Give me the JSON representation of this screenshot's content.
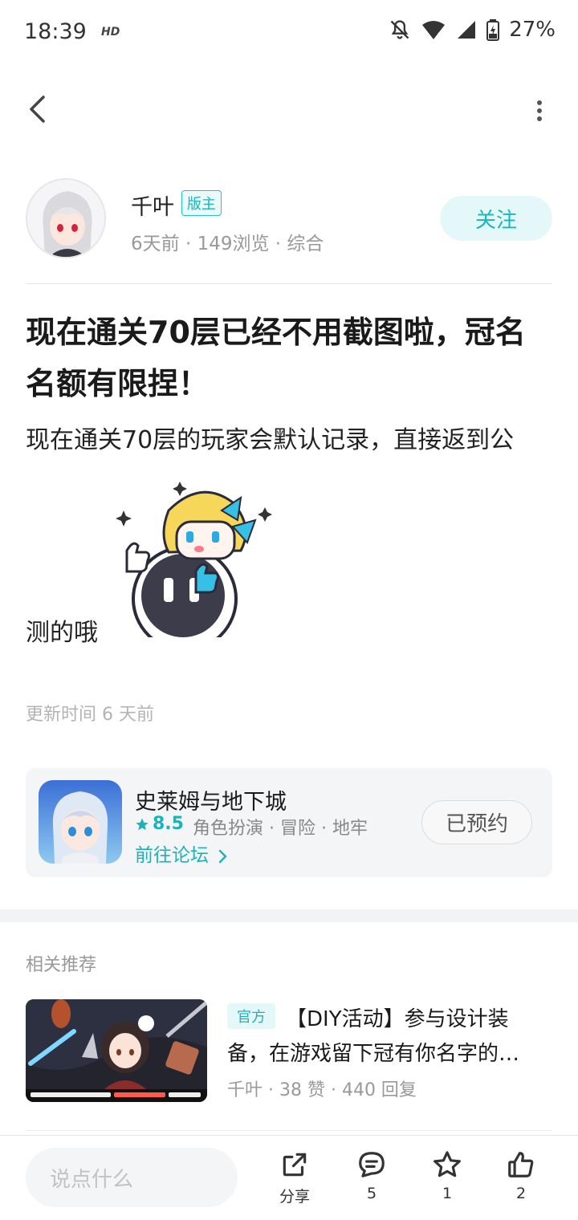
{
  "status_bar": {
    "time": "18:39",
    "hd": "HD",
    "battery": "27%"
  },
  "author": {
    "name": "千叶",
    "badge": "版主",
    "meta": "6天前 · 149浏览 · 综合",
    "follow_label": "关注"
  },
  "post": {
    "title": "现在通关70层已经不用截图啦，冠名名额有限捏！",
    "body_line1": "现在通关70层的玩家会默认记录，直接返到公",
    "body_line2": "测的哦",
    "update_time": "更新时间 6 天前"
  },
  "game_card": {
    "name": "史莱姆与地下城",
    "rating": "8.5",
    "tags": "角色扮演 · 冒险 · 地牢",
    "forum_link": "前往论坛",
    "reserve_label": "已预约"
  },
  "related": {
    "section_title": "相关推荐",
    "items": [
      {
        "tag": "官方",
        "title_line1": "【DIY活动】参与设计装",
        "title_line2": "备，在游戏留下冠有你名字的…",
        "meta": "千叶 · 38 赞 · 440 回复"
      }
    ]
  },
  "bottom_bar": {
    "input_placeholder": "说点什么",
    "share_label": "分享",
    "comment_count": "5",
    "favorite_count": "1",
    "like_count": "2"
  },
  "colors": {
    "accent": "#1bb3bb",
    "accent_bg": "#e5f8f9"
  },
  "icons": [
    "bell-off-icon",
    "wifi-icon",
    "signal-icon",
    "battery-icon",
    "back-icon",
    "more-icon",
    "star-icon",
    "chevron-right-icon",
    "share-icon",
    "comment-icon",
    "favorite-icon",
    "like-icon"
  ]
}
